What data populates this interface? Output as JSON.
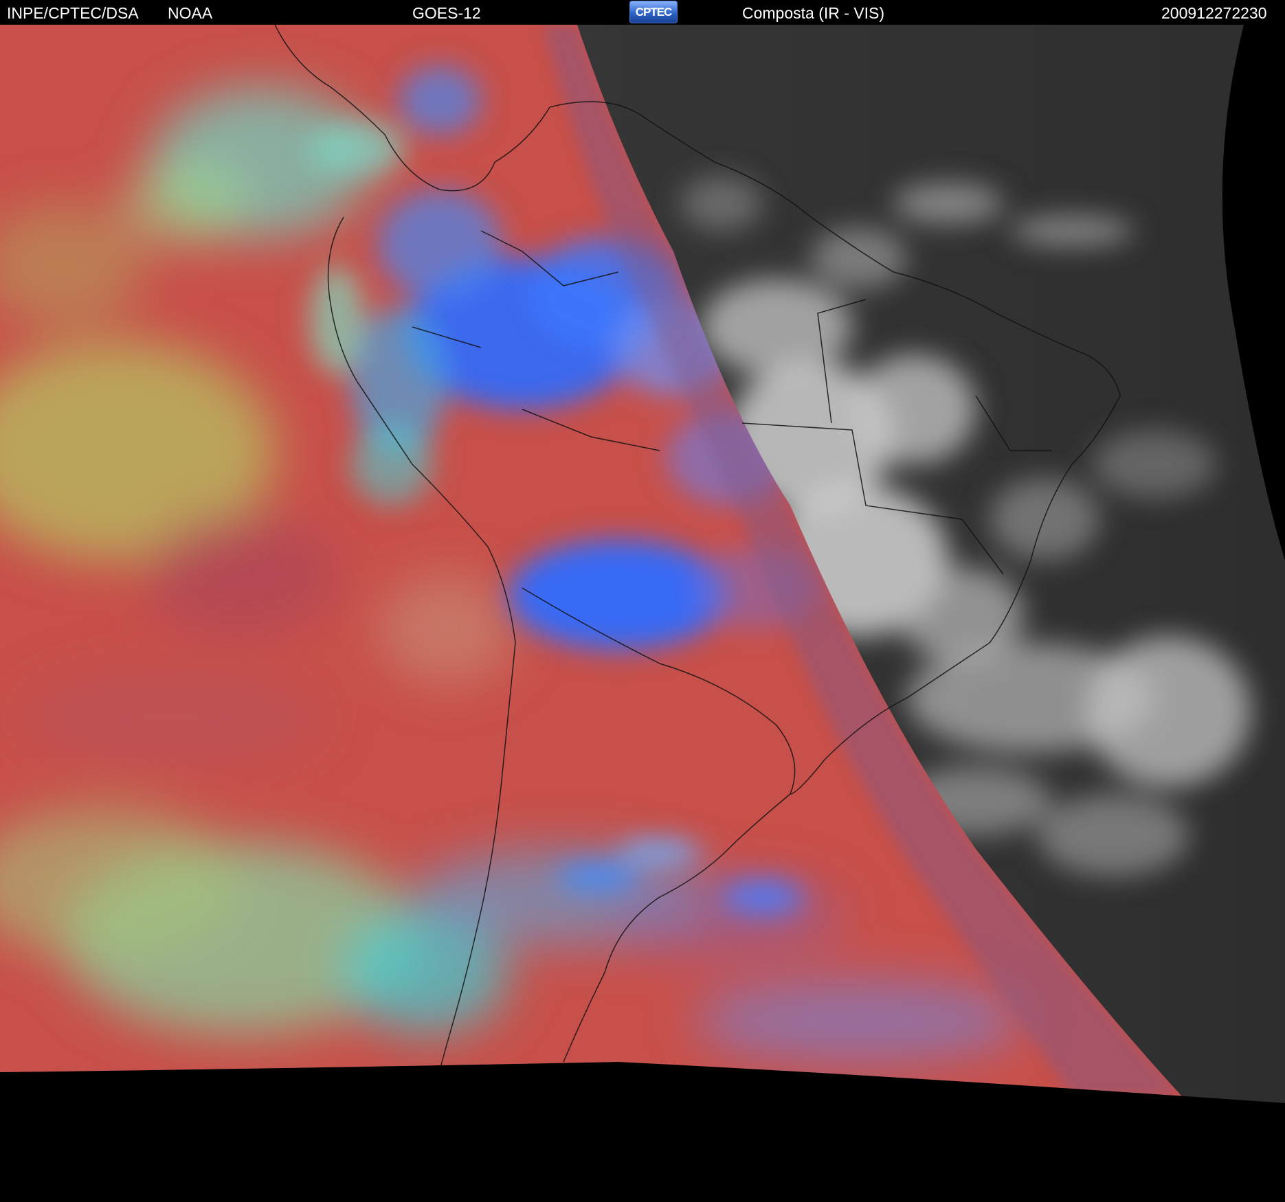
{
  "header": {
    "agency": "INPE/CPTEC/DSA",
    "partner": "NOAA",
    "satellite": "GOES-12",
    "logo_text": "CPTEC",
    "product": "Composta (IR - VIS)",
    "timestamp": "200912272230"
  },
  "colors": {
    "ir_base": "#c8504a",
    "ir_blue": "#2f6cff",
    "ir_cyan": "#3fd0d8",
    "ir_green": "#a8c85a",
    "vis_base": "#3a3a3a",
    "vis_cloud": "#d8d8d8",
    "space": "#000000"
  },
  "icons": [
    "cptec-logo"
  ]
}
